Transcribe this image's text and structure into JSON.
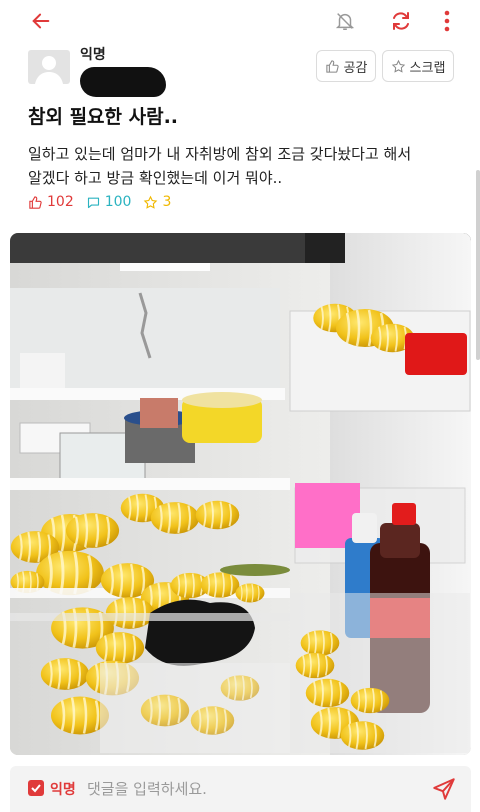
{
  "header": {
    "icons": [
      "back-arrow-icon",
      "bell-off-icon",
      "refresh-icon",
      "more-vert-icon"
    ]
  },
  "post": {
    "author": "익명",
    "empathy_label": "공감",
    "scrap_label": "스크랩",
    "title": "참외 필요한 사람..",
    "body_line1": "일하고 있는데 엄마가 내 자취방에 참외 조금 갖다놨다고 해서",
    "body_line2": "알겠다 하고 방금 확인했는데 이거 뭐야..",
    "likes": "102",
    "comments": "100",
    "scraps": "3"
  },
  "comment_bar": {
    "anon_label": "익명",
    "placeholder": "댓글을 입력하세요."
  },
  "colors": {
    "accent_red": "#e03a3a",
    "comment_blue": "#2bb3c0",
    "star_yellow": "#f0b800"
  }
}
